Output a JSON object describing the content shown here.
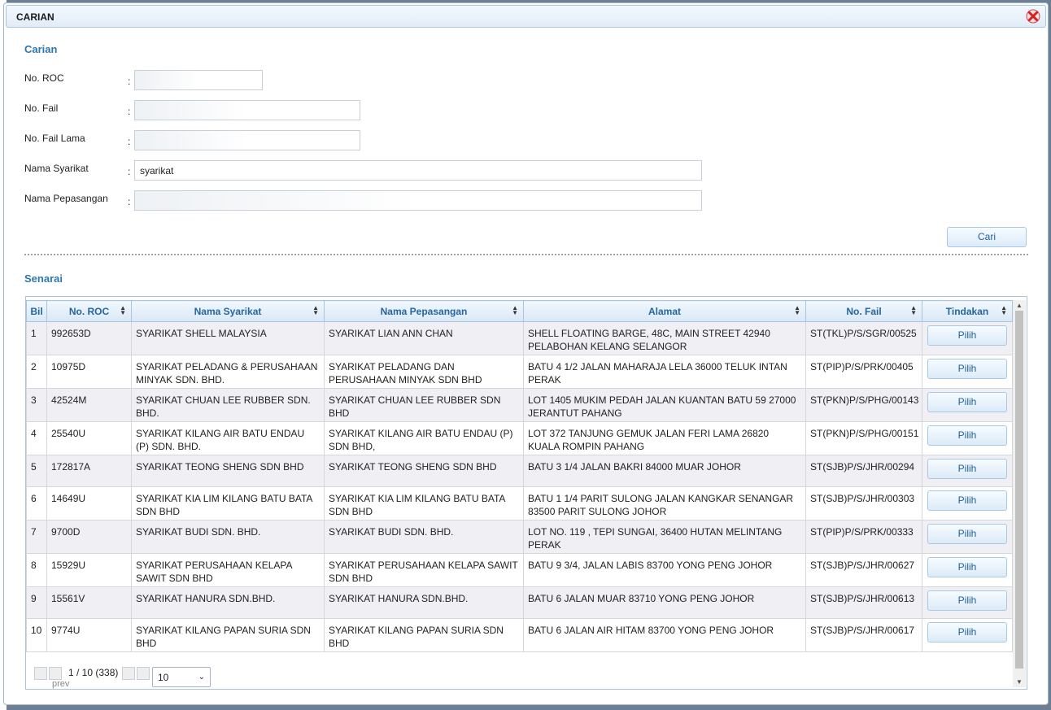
{
  "dialog": {
    "title": "CARIAN",
    "close_icon": "close-icon",
    "search": {
      "section_title": "Carian",
      "fields": [
        {
          "label": "No. ROC",
          "value": ""
        },
        {
          "label": "No. Fail",
          "value": ""
        },
        {
          "label": "No. Fail Lama",
          "value": ""
        },
        {
          "label": "Nama Syarikat",
          "value": "syarikat"
        },
        {
          "label": "Nama Pepasangan",
          "value": ""
        }
      ],
      "colon": ":",
      "search_button": "Cari"
    },
    "list": {
      "section_title": "Senarai",
      "columns": [
        "Bil",
        "No. ROC",
        "Nama Syarikat",
        "Nama Pepasangan",
        "Alamat",
        "No. Fail",
        "Tindakan"
      ],
      "action_label": "Pilih",
      "rows": [
        {
          "bil": "1",
          "roc": "992653D",
          "syarikat": "SYARIKAT SHELL MALAYSIA",
          "pepasangan": "SYARIKAT LIAN ANN CHAN",
          "alamat": "SHELL FLOATING BARGE, 48C, MAIN STREET 42940 PELABOHAN KELANG SELANGOR",
          "fail": "ST(TKL)P/S/SGR/00525"
        },
        {
          "bil": "2",
          "roc": "10975D",
          "syarikat": "SYARIKAT PELADANG & PERUSAHAAN MINYAK SDN. BHD.",
          "pepasangan": "SYARIKAT PELADANG DAN PERUSAHAAN MINYAK SDN BHD",
          "alamat": "BATU 4 1/2 JALAN MAHARAJA LELA 36000 TELUK INTAN PERAK",
          "fail": "ST(PIP)P/S/PRK/00405"
        },
        {
          "bil": "3",
          "roc": "42524M",
          "syarikat": "SYARIKAT CHUAN LEE RUBBER SDN. BHD.",
          "pepasangan": "SYARIKAT CHUAN LEE RUBBER SDN BHD",
          "alamat": "LOT 1405 MUKIM PEDAH JALAN KUANTAN BATU 59 27000 JERANTUT PAHANG",
          "fail": "ST(PKN)P/S/PHG/00143"
        },
        {
          "bil": "4",
          "roc": "25540U",
          "syarikat": "SYARIKAT KILANG AIR BATU ENDAU (P) SDN. BHD.",
          "pepasangan": "SYARIKAT KILANG AIR BATU ENDAU (P) SDN BHD,",
          "alamat": "LOT 372 TANJUNG GEMUK JALAN FERI LAMA 26820 KUALA ROMPIN PAHANG",
          "fail": "ST(PKN)P/S/PHG/00151"
        },
        {
          "bil": "5",
          "roc": "172817A",
          "syarikat": "SYARIKAT TEONG SHENG SDN BHD",
          "pepasangan": "SYARIKAT TEONG SHENG SDN BHD",
          "alamat": "BATU 3 1/4 JALAN BAKRI 84000 MUAR JOHOR",
          "fail": "ST(SJB)P/S/JHR/00294"
        },
        {
          "bil": "6",
          "roc": "14649U",
          "syarikat": "SYARIKAT KIA LIM KILANG BATU BATA SDN BHD",
          "pepasangan": "SYARIKAT KIA LIM KILANG BATU BATA SDN BHD",
          "alamat": "BATU 1 1/4 PARIT SULONG JALAN KANGKAR SENANGAR 83500 PARIT SULONG JOHOR",
          "fail": "ST(SJB)P/S/JHR/00303"
        },
        {
          "bil": "7",
          "roc": "9700D",
          "syarikat": "SYARIKAT BUDI SDN. BHD.",
          "pepasangan": "SYARIKAT BUDI SDN. BHD.",
          "alamat": "LOT NO. 119 , TEPI SUNGAI, 36400 HUTAN MELINTANG PERAK",
          "fail": "ST(PIP)P/S/PRK/00333"
        },
        {
          "bil": "8",
          "roc": "15929U",
          "syarikat": "SYARIKAT PERUSAHAAN KELAPA SAWIT SDN BHD",
          "pepasangan": "SYARIKAT PERUSAHAAN KELAPA SAWIT SDN BHD",
          "alamat": "BATU 9 3/4, JALAN LABIS 83700 YONG PENG JOHOR",
          "fail": "ST(SJB)P/S/JHR/00627"
        },
        {
          "bil": "9",
          "roc": "15561V",
          "syarikat": "SYARIKAT HANURA SDN.BHD.",
          "pepasangan": "SYARIKAT HANURA SDN.BHD.",
          "alamat": "BATU 6 JALAN MUAR 83710 YONG PENG JOHOR",
          "fail": "ST(SJB)P/S/JHR/00613"
        },
        {
          "bil": "10",
          "roc": "9774U",
          "syarikat": "SYARIKAT KILANG PAPAN SURIA SDN BHD",
          "pepasangan": "SYARIKAT KILANG PAPAN SURIA SDN BHD",
          "alamat": "BATU 6 JALAN AIR HITAM 83700 YONG PENG JOHOR",
          "fail": "ST(SJB)P/S/JHR/00617"
        }
      ],
      "pager": {
        "prev_alt": "prev",
        "page_info": "1 / 10 (338)",
        "page_size": "10"
      }
    }
  }
}
